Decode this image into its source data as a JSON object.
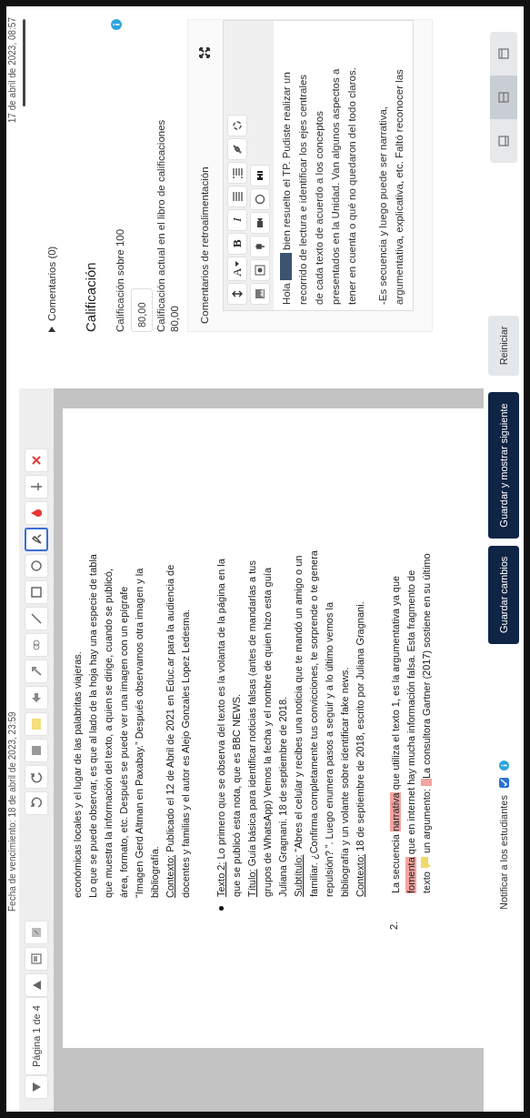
{
  "header": {
    "due_date": "Fecha de vencimiento: 18 de abril de 2023, 23:59"
  },
  "viewer_toolbar": {
    "page_label": "Página 1 de 4",
    "tools": [
      {
        "kind": "page-view",
        "selected": false
      },
      {
        "kind": "fit",
        "selected": false
      },
      {
        "kind": "rotate-left",
        "selected": false
      },
      {
        "kind": "rotate-right",
        "selected": false
      },
      {
        "kind": "stamp",
        "selected": false
      },
      {
        "kind": "swatch",
        "selected": false
      },
      {
        "kind": "arrow",
        "selected": false
      },
      {
        "kind": "hand",
        "selected": false
      },
      {
        "kind": "chain",
        "selected": false
      },
      {
        "kind": "line",
        "selected": false
      },
      {
        "kind": "rect",
        "selected": false
      },
      {
        "kind": "oval",
        "selected": false
      },
      {
        "kind": "pen",
        "selected": true
      },
      {
        "kind": "drop",
        "selected": false
      },
      {
        "kind": "pin",
        "selected": false
      },
      {
        "kind": "delete",
        "selected": false
      }
    ]
  },
  "document": {
    "blocks": [
      {
        "kind": "paragraph",
        "lines": [
          [
            {
              "kind": "plain",
              "text": "económicas locales y el lugar de las palabritas viajeras."
            }
          ],
          [
            {
              "kind": "plain",
              "text": "Lo que se puede observar, es que al lado de la hoja hay una especie de tabla"
            }
          ],
          [
            {
              "kind": "plain",
              "text": "que muestra la información del texto, a quien se dirige, cuando se publicó,"
            }
          ],
          [
            {
              "kind": "plain",
              "text": "área, formato, etc. Después se puede ver una imagen con un epígrafe"
            }
          ],
          [
            {
              "kind": "plain",
              "text": "“Imagen Gerd Altman en Paxabay.” Después observamos otra imagen y la"
            }
          ],
          [
            {
              "kind": "plain",
              "text": "bibliografía."
            }
          ],
          [
            {
              "kind": "underline",
              "text": "Contexto:"
            },
            {
              "kind": "plain",
              "text": " Publicado el 12 de Abril de 2021 en Educ.ar para la audiencia de"
            }
          ],
          [
            {
              "kind": "plain",
              "text": "docentes y familias y el autor es Alejo Gonzales Lopez Ledesma."
            }
          ]
        ]
      },
      {
        "kind": "bullet",
        "lines": [
          [
            {
              "kind": "underline",
              "text": "Texto 2:"
            },
            {
              "kind": "plain",
              "text": " Lo primero que se observa del texto es la volanta de la página en la"
            }
          ],
          [
            {
              "kind": "plain",
              "text": "que se publicó esta nota, que es BBC NEWS."
            }
          ],
          [
            {
              "kind": "underline",
              "text": "Título:"
            },
            {
              "kind": "plain",
              "text": " Guía básica para identificar noticias falsas (antes de mandarlas a tus"
            }
          ],
          [
            {
              "kind": "plain",
              "text": "grupos de WhatsApp) Vemos la fecha y el nombre de quien hizo esta guía"
            }
          ],
          [
            {
              "kind": "plain",
              "text": "Juliana Gragnani. 18 de septiembre de 2018."
            }
          ],
          [
            {
              "kind": "underline",
              "text": "Subtítulo:"
            },
            {
              "kind": "plain",
              "text": " “Abres el celular y recibes una noticia que te mandó un amigo o un"
            }
          ],
          [
            {
              "kind": "plain",
              "text": "familiar. ¿Confirma completamente tus convicciones, te sorprende o te genera"
            }
          ],
          [
            {
              "kind": "plain",
              "text": "repulsión? ”. Luego enumera pasos a seguir y a lo último vemos la"
            }
          ],
          [
            {
              "kind": "plain",
              "text": "bibliografía y un volante sobre identificar fake news."
            }
          ],
          [
            {
              "kind": "underline",
              "text": "Contexto:"
            },
            {
              "kind": "plain",
              "text": " 18 de septiembre de 2018, escrito por Juliana Gragnani."
            }
          ]
        ]
      },
      {
        "kind": "numbered",
        "number": "2.",
        "lines": [
          [
            {
              "kind": "plain",
              "text": "La secuencia "
            },
            {
              "kind": "highlight",
              "text": "narrativa"
            },
            {
              "kind": "plain",
              "text": " que utiliza el texto 1, es la argumentativa ya que"
            }
          ],
          [
            {
              "kind": "highlight",
              "text": "fomenta"
            },
            {
              "kind": "plain",
              "text": " que en internet hay mucha información falsa. Esta fragmento de"
            }
          ],
          [
            {
              "kind": "plain",
              "text": "texto "
            },
            {
              "kind": "note"
            },
            {
              "kind": "plain",
              "text": " un argumento: "
            },
            {
              "kind": "comment"
            },
            {
              "kind": "plain",
              "text": "La consultora Gartner (2017) sostiene en su último"
            }
          ]
        ]
      }
    ]
  },
  "grading": {
    "submitted_date": "17 de abril de 2023, 08:57",
    "comments_link": "Comentarios (0)",
    "heading": "Calificación",
    "grade_label": "Calificación sobre 100",
    "grade_value": "80,00",
    "current_label": "Calificación actual en el libro de calificaciones",
    "current_value": "80,00"
  },
  "feedback": {
    "label": "Comentarios de retroalimentación",
    "toolbar": [
      [
        {
          "kind": "collapse"
        },
        {
          "kind": "format",
          "label": "A"
        },
        {
          "kind": "bold",
          "label": "B"
        },
        {
          "kind": "italic",
          "label": "I"
        },
        {
          "kind": "bullets"
        },
        {
          "kind": "numbers"
        },
        {
          "kind": "link"
        },
        {
          "kind": "unlink"
        }
      ],
      [
        {
          "kind": "image"
        },
        {
          "kind": "media"
        },
        {
          "kind": "mic"
        },
        {
          "kind": "camera"
        },
        {
          "kind": "emoji"
        },
        {
          "kind": "h5p"
        }
      ]
    ],
    "lines": [
      [
        {
          "kind": "text",
          "text": "Hola "
        },
        {
          "kind": "redacted"
        },
        {
          "kind": "text",
          "text": " bien resuelto el TP. Pudiste realizar un"
        }
      ],
      [
        {
          "kind": "text",
          "text": "recorrido de lectura e identificar los ejes centrales"
        }
      ],
      [
        {
          "kind": "text",
          "text": "de cada texto de acuerdo a los conceptos"
        }
      ],
      [
        {
          "kind": "text",
          "text": "presentados en la Unidad. Van algunos aspectos a"
        }
      ],
      [
        {
          "kind": "text",
          "text": "tener en cuenta o qué no quedaron del todo claros."
        }
      ],
      [
        {
          "kind": "text",
          "text": "-Es secuencia y luego puede ser narrativa,"
        }
      ],
      [
        {
          "kind": "text",
          "text": "argumentativa, explicativa, etc. Faltó reconocer las"
        }
      ]
    ]
  },
  "footer": {
    "notify_label": "Notificar a los estudiantes",
    "notify_checked": true,
    "buttons": [
      {
        "label": "Guardar cambios",
        "kind": "primary"
      },
      {
        "label": "Guardar y mostrar siguiente",
        "kind": "primary"
      },
      {
        "label": "Reiniciar",
        "kind": "secondary"
      }
    ],
    "layout_modes": [
      {
        "selected": false
      },
      {
        "selected": true
      },
      {
        "selected": false
      }
    ]
  }
}
